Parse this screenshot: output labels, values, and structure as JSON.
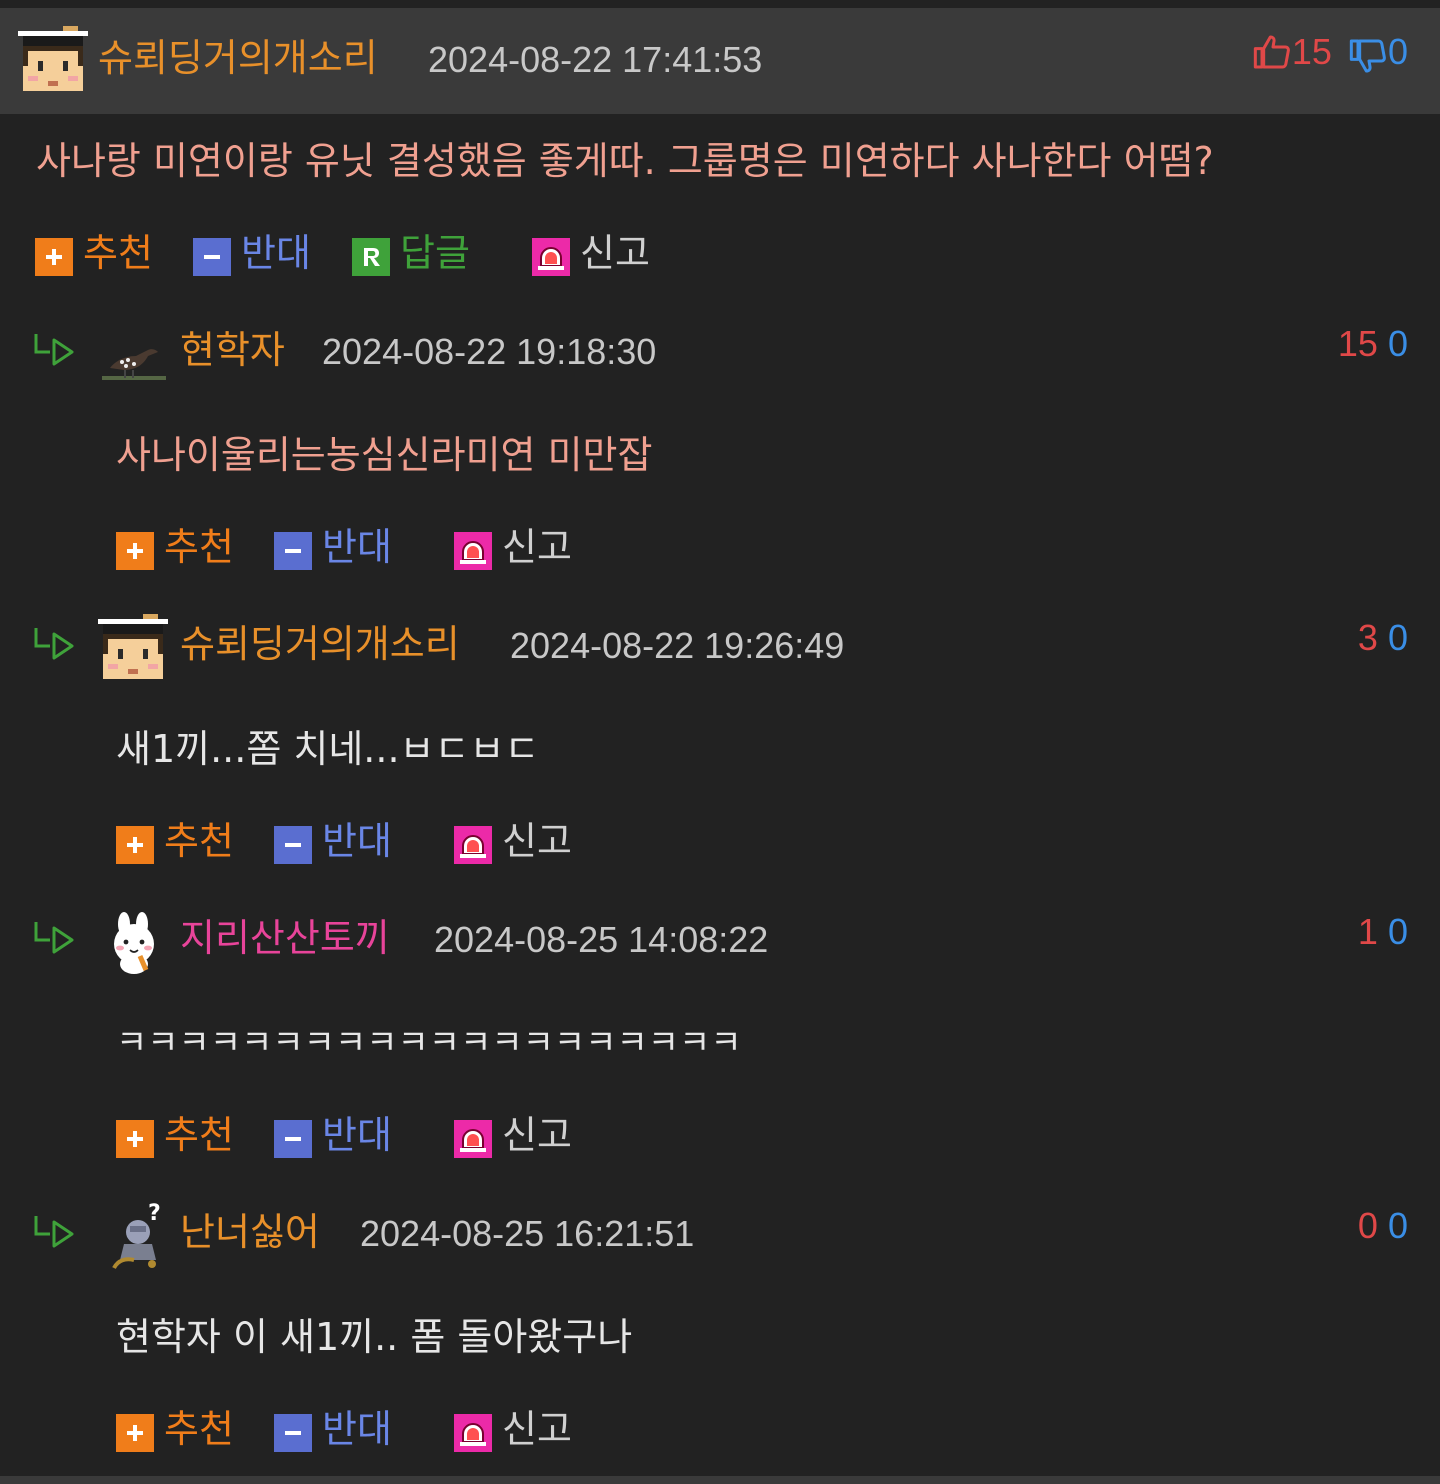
{
  "colors": {
    "background": "#222222",
    "header": "#3a3a3a",
    "nick_orange": "#e8902a",
    "nick_pink": "#e8449a",
    "date": "#c8c8c8",
    "upvote": "#e04848",
    "downvote": "#3a8ee6",
    "recommend": "#f07d1a",
    "oppose": "#5a6ed0",
    "reply": "#3fa23a",
    "report": "#ec2aa8",
    "main_text": "#f0a090",
    "reply_text_highlight": "#f0a090",
    "reply_text": "#e6e6e6"
  },
  "main_comment": {
    "nickname": "슈뢰딩거의개소리",
    "date": "2024-08-22 17:41:53",
    "up": "15",
    "down": "0",
    "up_icon": "thumbs-up-icon",
    "down_icon": "thumbs-down-icon",
    "text": "사나랑 미연이랑 유닛 결성했음 좋게따. 그룹명은 미연하다 사나한다 어떰?",
    "actions": {
      "recommend": "추천",
      "oppose": "반대",
      "reply": "답글",
      "report": "신고"
    }
  },
  "replies": [
    {
      "nickname": "현학자",
      "date": "2024-08-22 19:18:30",
      "up": "15",
      "down": "0",
      "text": "사나이울리는농심신라미연 미만잡",
      "actions": {
        "recommend": "추천",
        "oppose": "반대",
        "report": "신고"
      }
    },
    {
      "nickname": "슈뢰딩거의개소리",
      "date": "2024-08-22 19:26:49",
      "up": "3",
      "down": "0",
      "text": "새1끼...쫌 치네...ㅂㄷㅂㄷ",
      "actions": {
        "recommend": "추천",
        "oppose": "반대",
        "report": "신고"
      }
    },
    {
      "nickname": "지리산산토끼",
      "date": "2024-08-25 14:08:22",
      "up": "1",
      "down": "0",
      "text": "ㅋㅋㅋㅋㅋㅋㅋㅋㅋㅋㅋㅋㅋㅋㅋㅋㅋㅋㅋㅋ",
      "actions": {
        "recommend": "추천",
        "oppose": "반대",
        "report": "신고"
      }
    },
    {
      "nickname": "난너싫어",
      "date": "2024-08-25 16:21:51",
      "up": "0",
      "down": "0",
      "text": "현학자 이 새1끼.. 폼 돌아왔구나",
      "actions": {
        "recommend": "추천",
        "oppose": "반대",
        "report": "신고"
      }
    }
  ],
  "icons": {
    "recommend": "plus-icon",
    "oppose": "minus-icon",
    "reply": "reply-r-icon",
    "report": "siren-icon",
    "reply_marker": "reply-arrow-icon"
  }
}
